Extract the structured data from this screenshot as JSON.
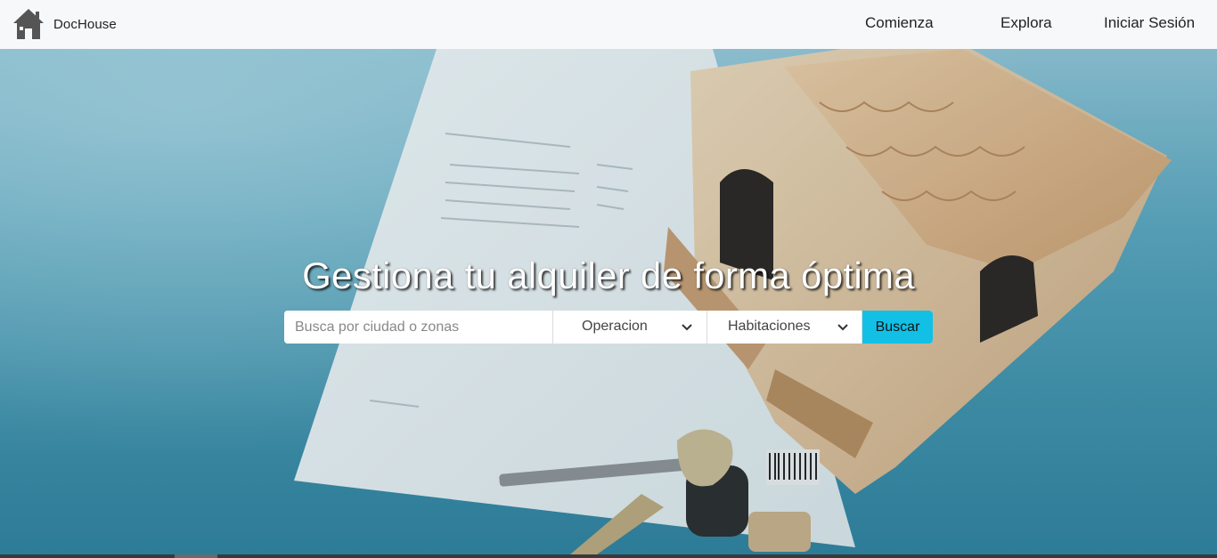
{
  "navbar": {
    "brand_name": "DocHouse",
    "links": [
      {
        "label": "Comienza"
      },
      {
        "label": "Explora"
      },
      {
        "label": "Iniciar Sesión"
      }
    ]
  },
  "hero": {
    "title": "Gestiona tu alquiler de forma óptima"
  },
  "search": {
    "placeholder": "Busca por ciudad o zonas",
    "value": "",
    "operation_select": {
      "selected": "Operacion"
    },
    "rooms_select": {
      "selected": "Habitaciones"
    },
    "button_label": "Buscar"
  },
  "colors": {
    "accent": "#12c0e6",
    "navbar_bg": "#f7f8fa",
    "hero_bg": "#4a97b0"
  },
  "icons": {
    "brand": "house-icon",
    "select_arrow": "chevron-down-icon"
  }
}
